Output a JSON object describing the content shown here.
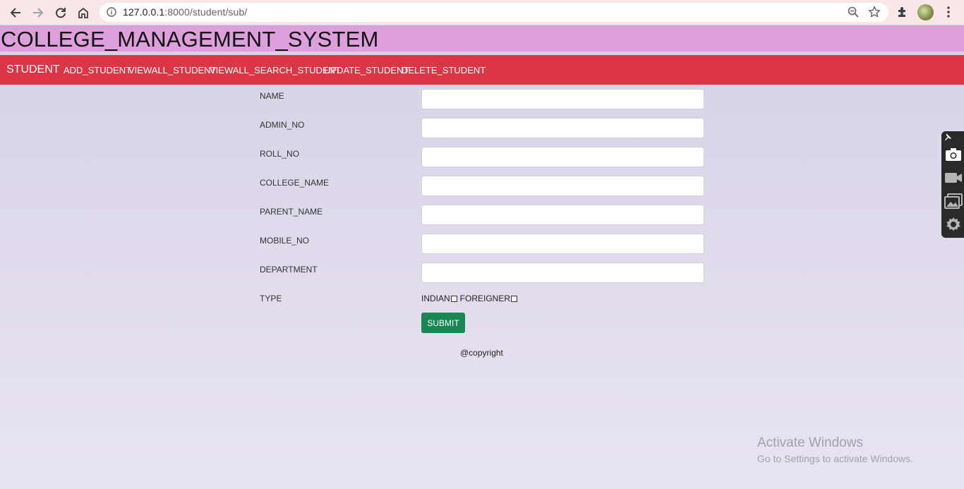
{
  "browser": {
    "url_host": "127.0.0.1",
    "url_path": ":8000/student/sub/",
    "icons": [
      "back-arrow-icon",
      "forward-arrow-icon",
      "reload-icon",
      "home-icon",
      "info-icon",
      "zoom-icon",
      "star-icon",
      "puzzle-icon",
      "avatar",
      "kebab-menu-icon"
    ]
  },
  "header": {
    "title": "COLLEGE_MANAGEMENT_SYSTEM"
  },
  "nav": {
    "brand": "STUDENT",
    "links": [
      "ADD_STUDENT",
      "VIEWALL_STUDENT",
      "VIEWALL_SEARCH_STUDENT",
      "UPDATE_STUDENT",
      "DELETE_STUDENT"
    ]
  },
  "form": {
    "fields": [
      {
        "label": "NAME",
        "value": ""
      },
      {
        "label": "ADMIN_NO",
        "value": ""
      },
      {
        "label": "ROLL_NO",
        "value": ""
      },
      {
        "label": "COLLEGE_NAME",
        "value": ""
      },
      {
        "label": "PARENT_NAME",
        "value": ""
      },
      {
        "label": "MOBILE_NO",
        "value": ""
      },
      {
        "label": "DEPARTMENT",
        "value": ""
      }
    ],
    "type_label": "TYPE",
    "type_options": [
      {
        "label": "INDIAN",
        "checked": false
      },
      {
        "label": "FOREIGNER",
        "checked": false
      }
    ],
    "submit_label": "SUBMIT"
  },
  "footer": {
    "copyright": "@copyright"
  },
  "watermark": {
    "line1": "Activate Windows",
    "line2": "Go to Settings to activate Windows."
  },
  "side_toolbar": {
    "icons": [
      "pin-icon",
      "camera-icon",
      "video-icon",
      "gallery-icon",
      "settings-icon"
    ]
  },
  "colors": {
    "header_bg": "#dea0dc",
    "nav_bg": "#dc3545",
    "submit_bg": "#198754"
  }
}
